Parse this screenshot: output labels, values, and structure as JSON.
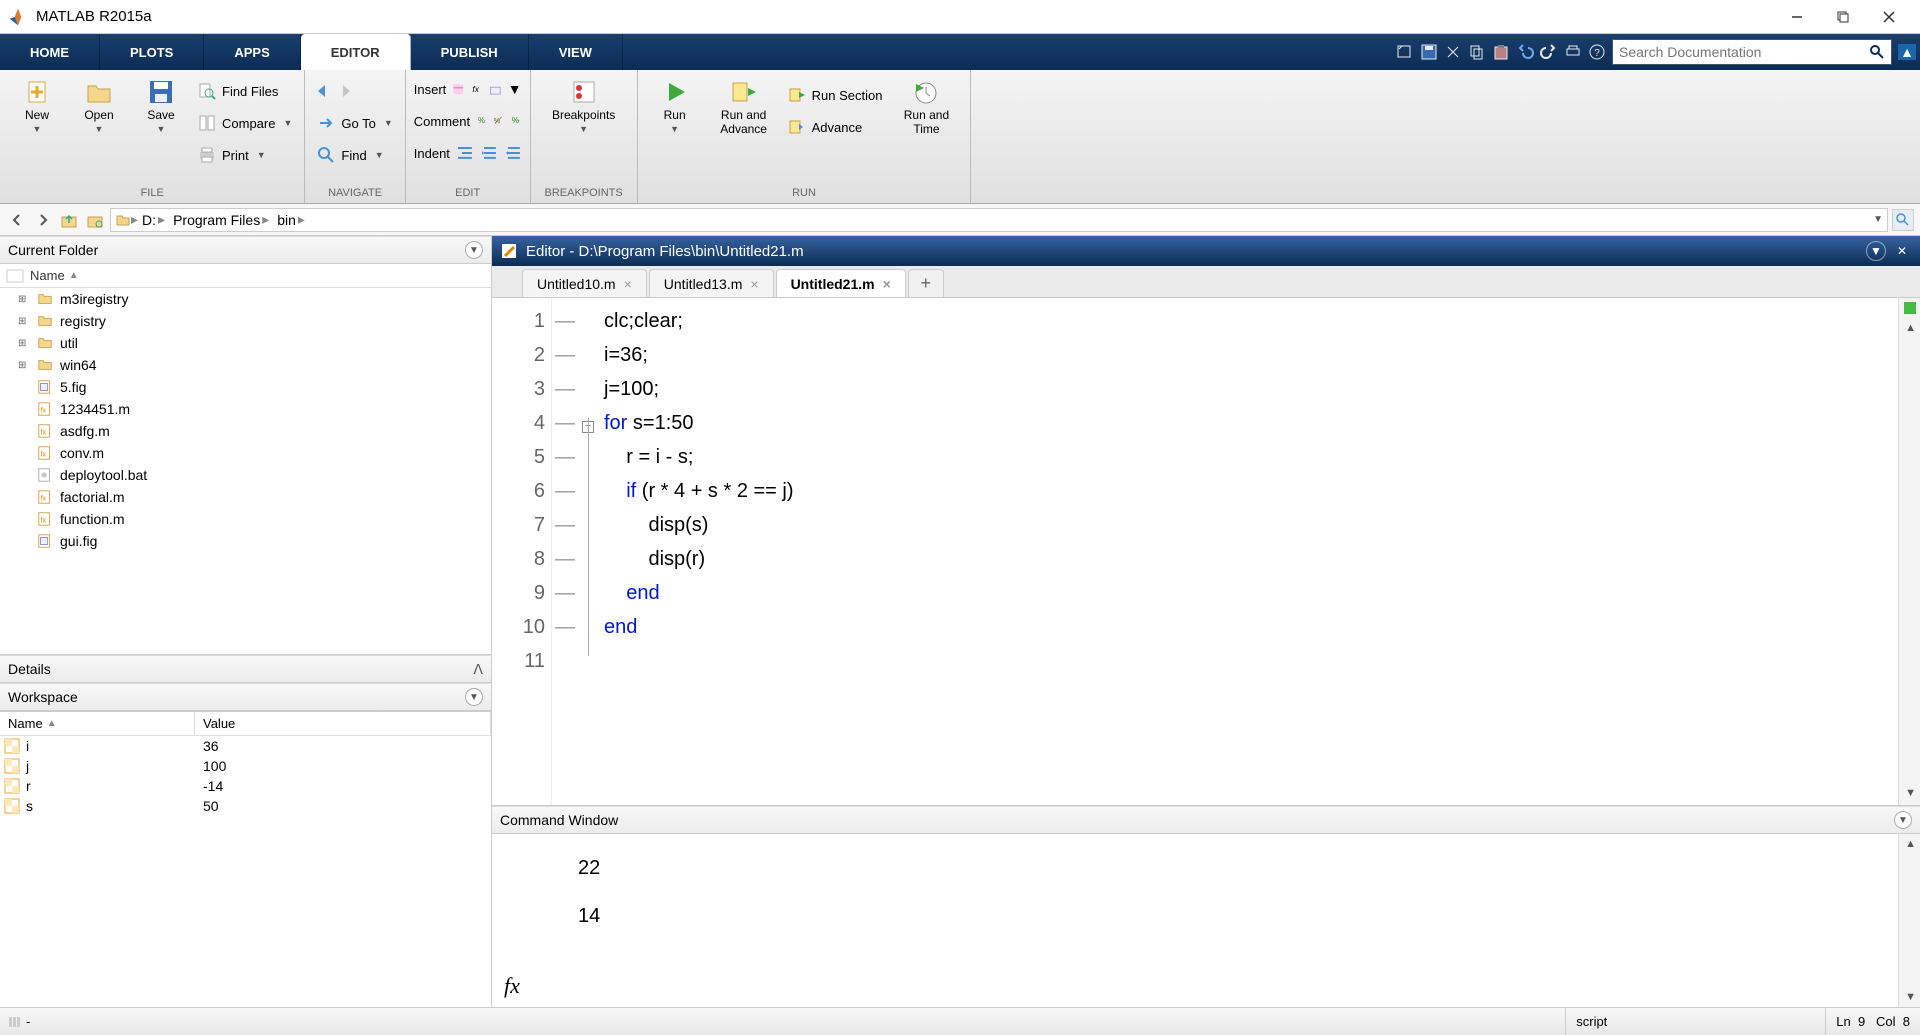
{
  "window": {
    "title": "MATLAB R2015a"
  },
  "tabs": {
    "items": [
      "HOME",
      "PLOTS",
      "APPS",
      "EDITOR",
      "PUBLISH",
      "VIEW"
    ],
    "active": 3
  },
  "search": {
    "placeholder": "Search Documentation"
  },
  "ribbon": {
    "file": {
      "label": "FILE",
      "new": "New",
      "open": "Open",
      "save": "Save",
      "findfiles": "Find Files",
      "compare": "Compare",
      "print": "Print"
    },
    "navigate": {
      "label": "NAVIGATE",
      "goto": "Go To",
      "find": "Find"
    },
    "edit": {
      "label": "EDIT",
      "insert": "Insert",
      "comment": "Comment",
      "indent": "Indent"
    },
    "breakpoints": {
      "label": "BREAKPOINTS",
      "btn": "Breakpoints"
    },
    "run": {
      "label": "RUN",
      "run": "Run",
      "runadv": "Run and\nAdvance",
      "runsec": "Run Section",
      "advance": "Advance",
      "runtime": "Run and\nTime"
    }
  },
  "path": {
    "drive": "D:",
    "parts": [
      "Program Files",
      "bin"
    ]
  },
  "currentFolder": {
    "title": "Current Folder",
    "col": "Name",
    "items": [
      {
        "name": "m3iregistry",
        "type": "folder",
        "exp": true
      },
      {
        "name": "registry",
        "type": "folder",
        "exp": true
      },
      {
        "name": "util",
        "type": "folder",
        "exp": true
      },
      {
        "name": "win64",
        "type": "folder",
        "exp": true
      },
      {
        "name": "5.fig",
        "type": "fig"
      },
      {
        "name": "1234451.m",
        "type": "m"
      },
      {
        "name": "asdfg.m",
        "type": "m"
      },
      {
        "name": "conv.m",
        "type": "m"
      },
      {
        "name": "deploytool.bat",
        "type": "bat"
      },
      {
        "name": "factorial.m",
        "type": "m"
      },
      {
        "name": "function.m",
        "type": "m"
      },
      {
        "name": "gui.fig",
        "type": "fig"
      }
    ]
  },
  "details": {
    "title": "Details"
  },
  "workspace": {
    "title": "Workspace",
    "cols": {
      "name": "Name",
      "value": "Value"
    },
    "vars": [
      {
        "name": "i",
        "value": "36"
      },
      {
        "name": "j",
        "value": "100"
      },
      {
        "name": "r",
        "value": "-14"
      },
      {
        "name": "s",
        "value": "50"
      }
    ]
  },
  "editor": {
    "title": "Editor - D:\\Program Files\\bin\\Untitled21.m",
    "tabs": [
      {
        "label": "Untitled10.m",
        "active": false
      },
      {
        "label": "Untitled13.m",
        "active": false
      },
      {
        "label": "Untitled21.m",
        "active": true
      }
    ],
    "lines": [
      {
        "n": 1,
        "dash": true,
        "text": "clc;clear;"
      },
      {
        "n": 2,
        "dash": true,
        "text": "i=36;"
      },
      {
        "n": 3,
        "dash": true,
        "text": "j=100;"
      },
      {
        "n": 4,
        "dash": true,
        "text": "for s=1:50",
        "kw": "for"
      },
      {
        "n": 5,
        "dash": true,
        "text": "    r = i - s;"
      },
      {
        "n": 6,
        "dash": true,
        "text": "    if (r * 4 + s * 2 == j)",
        "kw": "if"
      },
      {
        "n": 7,
        "dash": true,
        "text": "        disp(s)"
      },
      {
        "n": 8,
        "dash": true,
        "text": "        disp(r)"
      },
      {
        "n": 9,
        "dash": true,
        "text": "    end",
        "kw": "end"
      },
      {
        "n": 10,
        "dash": false,
        "text": ""
      },
      {
        "n": 11,
        "dash": true,
        "text": "end",
        "kw": "end"
      }
    ]
  },
  "commandWindow": {
    "title": "Command Window",
    "output": [
      "22",
      "",
      "14"
    ]
  },
  "status": {
    "type": "script",
    "ln_label": "Ln",
    "ln": "9",
    "col_label": "Col",
    "col": "8"
  }
}
